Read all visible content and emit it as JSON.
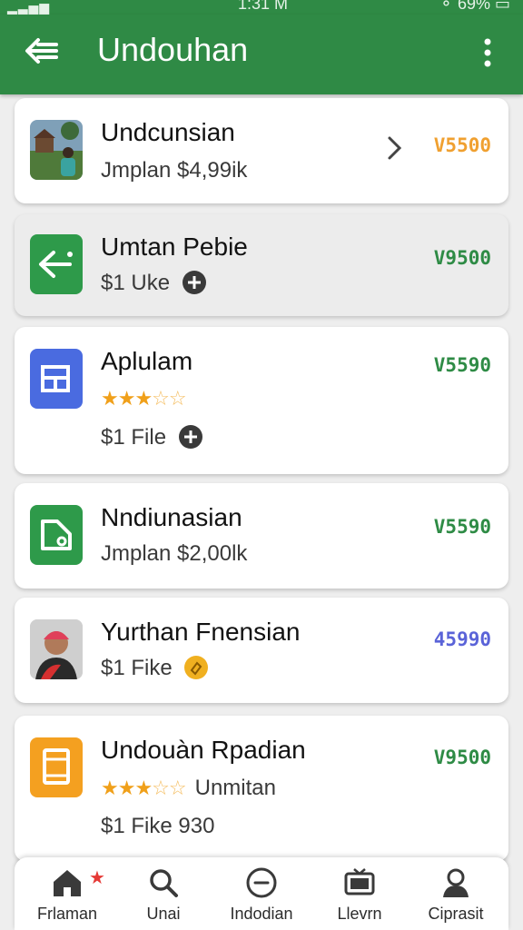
{
  "status_bar": {
    "time": "1:31 M",
    "battery": "69%"
  },
  "app_bar": {
    "title": "Undouhan",
    "back_icon": "back-arrow-icon",
    "menu_icon": "more-vert-icon",
    "color": "#2f8a45"
  },
  "items": [
    {
      "name": "Undcunsian",
      "subtitle": "Jmplan  $4,99ik",
      "price": "V5500",
      "price_color": "#f0a030",
      "thumb": "photo-thumbnail"
    },
    {
      "name": "Umtan Pebie",
      "subtitle": "$1 Uke",
      "price": "V9500",
      "price_color": "#2e8b45",
      "thumb": "green-arrow-app-icon"
    },
    {
      "name": "Aplulam",
      "rating": 3.5,
      "subtitle": "$1 File",
      "price": "V5590",
      "price_color": "#2e8b45",
      "thumb": "blue-window-app-icon"
    },
    {
      "name": "Nndiunasian",
      "subtitle": "Jmplan  $2,00lk",
      "price": "V5590",
      "price_color": "#2e8b45",
      "thumb": "green-folder-app-icon"
    },
    {
      "name": "Yurthan Fnensian",
      "subtitle": "$1 Fike",
      "price": "45990",
      "price_color": "#5a63d8",
      "thumb": "person-photo-thumbnail"
    },
    {
      "name": "Undouàn Rpadian",
      "rating": 3.5,
      "rating_text": "Unmitan",
      "subtitle": "$1 Fike 930",
      "price": "V9500",
      "price_color": "#2e8b45",
      "thumb": "orange-tablet-app-icon"
    }
  ],
  "bottom_nav": [
    {
      "label": "Frlaman",
      "icon": "home-icon",
      "badge": "★"
    },
    {
      "label": "Unai",
      "icon": "search-icon"
    },
    {
      "label": "Indodian",
      "icon": "minus-circle-icon"
    },
    {
      "label": "Llevrn",
      "icon": "tv-icon"
    },
    {
      "label": "Ciprasit",
      "icon": "profile-icon"
    }
  ]
}
